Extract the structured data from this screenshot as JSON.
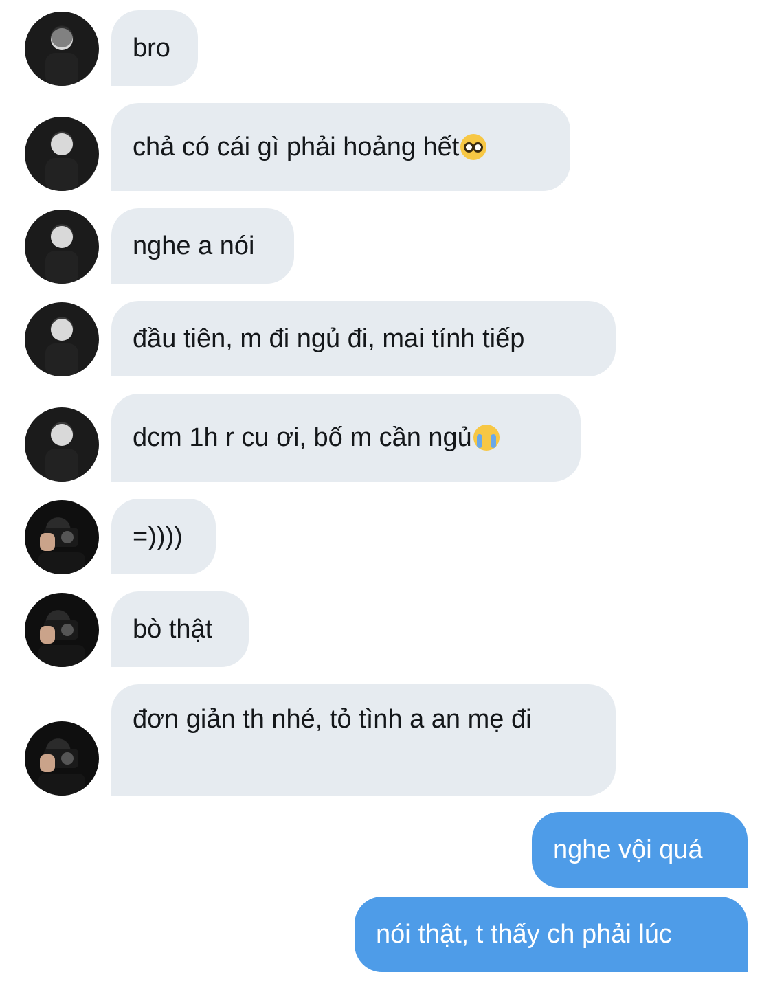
{
  "conversation": {
    "messages": [
      {
        "from": "them",
        "avatar": "avatar-a",
        "text": "bro"
      },
      {
        "from": "them",
        "avatar": "avatar-a",
        "text": "chả có cái gì phải hoảng hết",
        "emoji": "nerd-face-emoji"
      },
      {
        "from": "them",
        "avatar": "avatar-a",
        "text": "nghe a nói"
      },
      {
        "from": "them",
        "avatar": "avatar-a",
        "text": "đầu tiên, m đi ngủ đi, mai tính tiếp"
      },
      {
        "from": "them",
        "avatar": "avatar-a",
        "text": "dcm 1h r cu ơi, bố m cần ngủ",
        "emoji": "loudly-crying-face-emoji"
      },
      {
        "from": "them",
        "avatar": "avatar-b",
        "text": "=))))"
      },
      {
        "from": "them",
        "avatar": "avatar-b",
        "text": "bò thật"
      },
      {
        "from": "them",
        "avatar": "avatar-b",
        "text": "đơn giản th nhé, tỏ tình a an mẹ đi"
      },
      {
        "from": "me",
        "text": "nghe vội quá"
      },
      {
        "from": "me",
        "text": "nói thật, t thấy ch phải lúc"
      }
    ]
  },
  "colors": {
    "incoming_bubble": "#e6ebf0",
    "outgoing_bubble": "#4e9ce8",
    "incoming_text": "#14171a",
    "outgoing_text": "#ffffff"
  }
}
